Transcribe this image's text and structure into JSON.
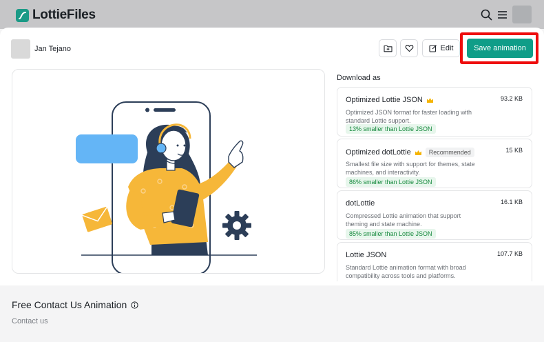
{
  "brand": {
    "name": "LottieFiles",
    "accent": "#0f9d88"
  },
  "header": {
    "icons": [
      "search-icon",
      "menu-icon"
    ]
  },
  "author": {
    "name": "Jan Tejano"
  },
  "toolbar": {
    "edit_label": "Edit",
    "save_label": "Save animation",
    "highlight_color": "#ee0c0c"
  },
  "download": {
    "title": "Download as",
    "options": [
      {
        "name": "Optimized Lottie JSON",
        "premium": true,
        "badge": "",
        "size": "93.2 KB",
        "desc": "Optimized JSON format for faster loading with standard Lottie support.",
        "chip": "13% smaller than Lottie JSON"
      },
      {
        "name": "Optimized dotLottie",
        "premium": true,
        "badge": "Recommended",
        "size": "15 KB",
        "desc": "Smallest file size with support for themes, state machines, and interactivity.",
        "chip": "86% smaller than Lottie JSON"
      },
      {
        "name": "dotLottie",
        "premium": false,
        "badge": "",
        "size": "16.1 KB",
        "desc": "Compressed Lottie animation that support theming and state machine.",
        "chip": "85% smaller than Lottie JSON"
      },
      {
        "name": "Lottie JSON",
        "premium": false,
        "badge": "",
        "size": "107.7 KB",
        "desc": "Standard Lottie animation format with broad compatibility across tools and platforms.",
        "chip": ""
      }
    ]
  },
  "footer": {
    "title": "Free Contact Us Animation",
    "subtitle": "Contact us"
  }
}
